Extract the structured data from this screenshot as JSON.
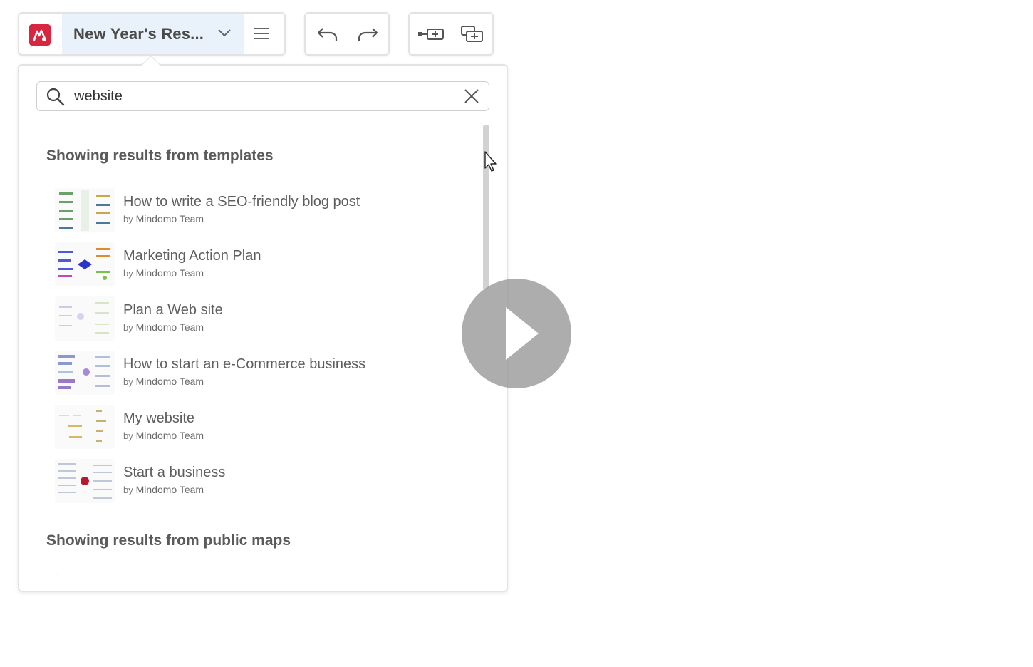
{
  "toolbar": {
    "map_title": "New Year's Res...",
    "logo": "mindomo-logo-icon",
    "colors": {
      "brand": "#d7263d",
      "title_bg": "#e9f2fa"
    }
  },
  "search": {
    "value": "website",
    "placeholder": ""
  },
  "templates_section": {
    "heading": "Showing results from templates",
    "results": [
      {
        "title": "How to write a SEO-friendly blog post",
        "by": "by",
        "author": "Mindomo Team"
      },
      {
        "title": "Marketing Action Plan",
        "by": "by",
        "author": "Mindomo Team"
      },
      {
        "title": "Plan a Web site",
        "by": "by",
        "author": "Mindomo Team"
      },
      {
        "title": "How to start an e-Commerce business",
        "by": "by",
        "author": "Mindomo Team"
      },
      {
        "title": "My website",
        "by": "by",
        "author": "Mindomo Team"
      },
      {
        "title": "Start a business",
        "by": "by",
        "author": "Mindomo Team"
      }
    ]
  },
  "public_section": {
    "heading": "Showing results from public maps"
  }
}
